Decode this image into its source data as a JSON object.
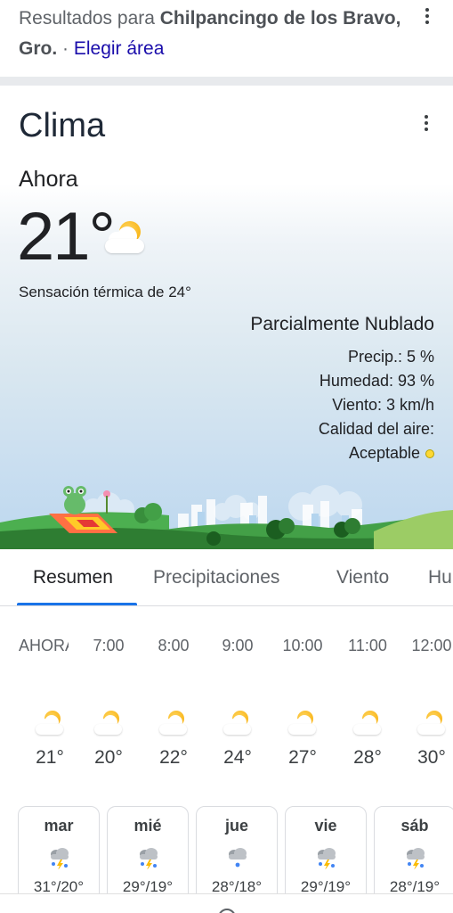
{
  "results": {
    "prefix": "Resultados para ",
    "location": "Chilpancingo de los Bravo, Gro.",
    "separator": " · ",
    "change_area": "Elegir área"
  },
  "weather": {
    "title": "Clima",
    "now_label": "Ahora",
    "temperature": "21°",
    "feels_like": "Sensación térmica de 24°",
    "condition": "Parcialmente Nublado",
    "precip": "Precip.: 5 %",
    "humidity": "Humedad: 93 %",
    "wind": "Viento: 3 km/h",
    "air_quality_label": "Calidad del aire:",
    "air_quality_value": "Aceptable",
    "air_quality_color": "#fdd835",
    "current_icon": "partly-cloudy-icon"
  },
  "tabs": [
    {
      "label": "Resumen",
      "active": true
    },
    {
      "label": "Precipitaciones",
      "active": false
    },
    {
      "label": "Viento",
      "active": false
    },
    {
      "label": "Hu",
      "active": false
    }
  ],
  "hourly": [
    {
      "time": "AHORA",
      "temp": "21°",
      "icon": "partly-cloudy-icon"
    },
    {
      "time": "7:00",
      "temp": "20°",
      "icon": "partly-cloudy-icon"
    },
    {
      "time": "8:00",
      "temp": "22°",
      "icon": "partly-cloudy-icon"
    },
    {
      "time": "9:00",
      "temp": "24°",
      "icon": "partly-cloudy-icon"
    },
    {
      "time": "10:00",
      "temp": "27°",
      "icon": "partly-cloudy-icon"
    },
    {
      "time": "11:00",
      "temp": "28°",
      "icon": "partly-cloudy-icon"
    },
    {
      "time": "12:00",
      "temp": "30°",
      "icon": "partly-cloudy-icon"
    }
  ],
  "daily": [
    {
      "day": "mar",
      "temp": "31°/20°",
      "icon": "thunderstorm-icon"
    },
    {
      "day": "mié",
      "temp": "29°/19°",
      "icon": "thunderstorm-icon"
    },
    {
      "day": "jue",
      "temp": "28°/18°",
      "icon": "rain-cloud-icon"
    },
    {
      "day": "vie",
      "temp": "29°/19°",
      "icon": "thunderstorm-icon"
    },
    {
      "day": "sáb",
      "temp": "28°/19°",
      "icon": "thunderstorm-icon"
    }
  ],
  "colors": {
    "link": "#1a0dab",
    "tab_accent": "#1a73e8",
    "sun": "#f9ab00"
  }
}
